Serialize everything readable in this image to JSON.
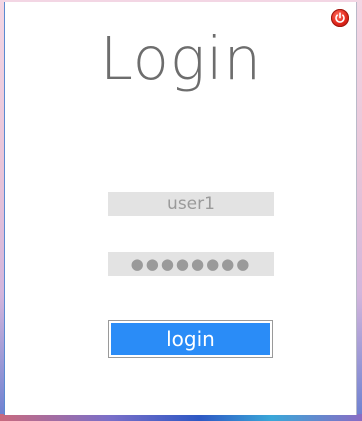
{
  "window": {
    "title": "Login",
    "power_icon": "power-icon",
    "accent_color": "#2a8cf7",
    "power_color": "#e0261a"
  },
  "form": {
    "username_value": "user1",
    "password_value": "●●●●●●●●",
    "login_label": "login"
  }
}
